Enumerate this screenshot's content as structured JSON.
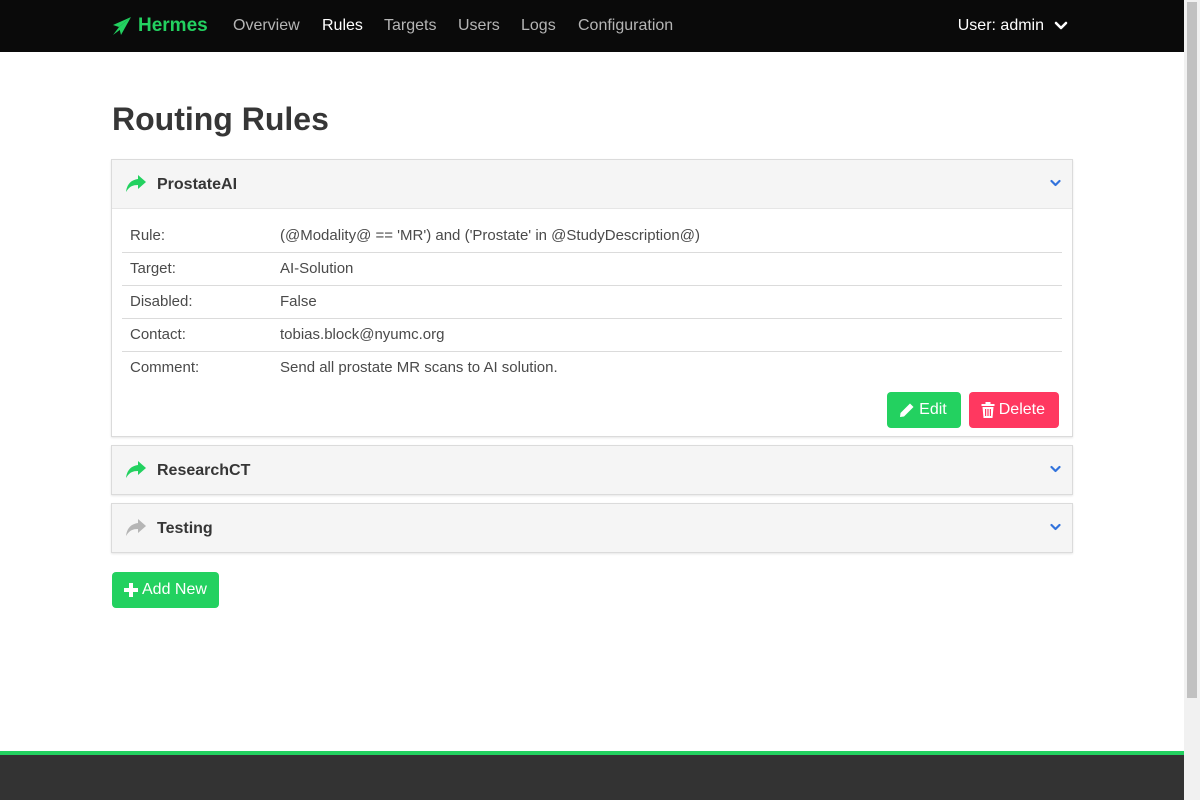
{
  "app": {
    "brand": "Hermes"
  },
  "nav": {
    "items": [
      {
        "label": "Overview"
      },
      {
        "label": "Rules"
      },
      {
        "label": "Targets"
      },
      {
        "label": "Users"
      },
      {
        "label": "Logs"
      },
      {
        "label": "Configuration"
      }
    ],
    "active": "Rules",
    "user_label": "User: admin"
  },
  "page": {
    "title": "Routing Rules"
  },
  "rules": [
    {
      "name": "ProstateAI",
      "expanded": true,
      "enabled": true,
      "fields": [
        {
          "label": "Rule:",
          "value": "(@Modality@ == 'MR') and ('Prostate' in @StudyDescription@)"
        },
        {
          "label": "Target:",
          "value": "AI-Solution"
        },
        {
          "label": "Disabled:",
          "value": "False"
        },
        {
          "label": "Contact:",
          "value": "tobias.block@nyumc.org"
        },
        {
          "label": "Comment:",
          "value": "Send all prostate MR scans to AI solution."
        }
      ],
      "edit_label": "Edit",
      "delete_label": "Delete"
    },
    {
      "name": "ResearchCT",
      "expanded": false,
      "enabled": true
    },
    {
      "name": "Testing",
      "expanded": false,
      "enabled": false
    }
  ],
  "add_new_label": "Add New",
  "colors": {
    "brand": "#23d160",
    "danger": "#ff3860",
    "navbar": "#0a0a0a",
    "icon_disabled": "#b5b5b5",
    "chevron": "#3273dc"
  },
  "icons": {
    "brand": "paper-plane-icon",
    "rule": "share-arrow-icon",
    "expand": "chevron-down-icon",
    "edit": "pencil-icon",
    "delete": "trash-icon",
    "add": "plus-icon"
  }
}
